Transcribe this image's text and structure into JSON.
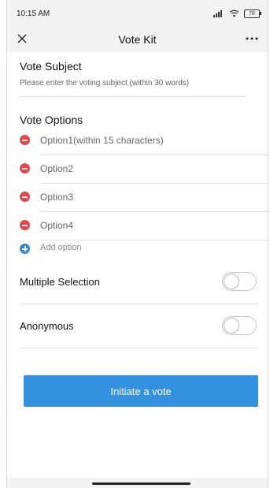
{
  "status_bar": {
    "time": "10:15 AM",
    "battery": "78"
  },
  "nav": {
    "title": "Vote Kit",
    "close_icon": "close-icon",
    "more_icon": "more-icon"
  },
  "subject": {
    "title": "Vote Subject",
    "placeholder": "Please enter the voting subject (within 30 words)"
  },
  "options": {
    "title": "Vote Options",
    "items": [
      {
        "placeholder": "Option1(within 15 characters)"
      },
      {
        "placeholder": "Option2"
      },
      {
        "placeholder": "Option3"
      },
      {
        "placeholder": "Option4"
      }
    ],
    "add_label": "Add option"
  },
  "settings": {
    "multiple_selection": {
      "label": "Multiple Selection",
      "enabled": false
    },
    "anonymous": {
      "label": "Anonymous",
      "enabled": false
    }
  },
  "submit_label": "Initiate a vote",
  "colors": {
    "accent": "#3392e0",
    "remove": "#ec4446",
    "add": "#2e86de",
    "header_bg": "#f2f2f2"
  }
}
